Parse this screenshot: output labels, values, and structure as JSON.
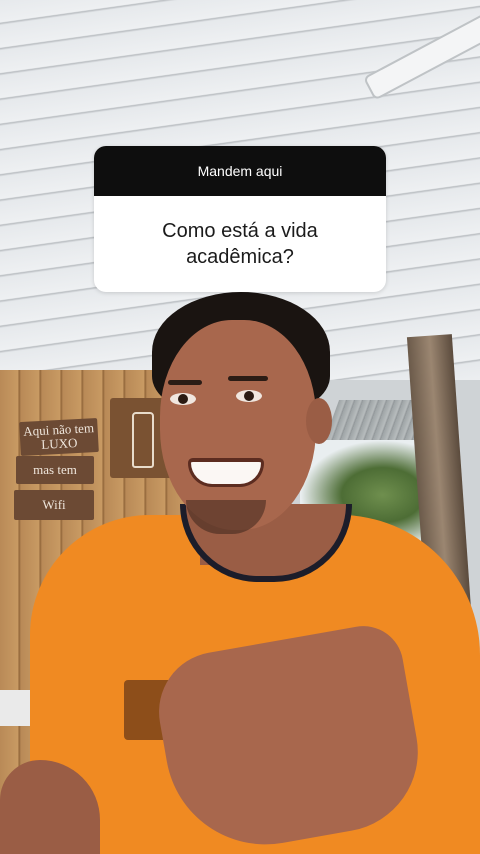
{
  "question_sticker": {
    "header": "Mandem aqui",
    "question_line1": "Como está a vida",
    "question_line2": "acadêmica?"
  },
  "background_signs": {
    "sign1_line1": "Aqui não tem",
    "sign1_line2": "LUXO",
    "sign2": "mas tem",
    "sign3": "Wifi"
  },
  "colors": {
    "sticker_header_bg": "#0e0e0e",
    "sticker_body_bg": "#ffffff",
    "shirt": "#f08a22"
  }
}
